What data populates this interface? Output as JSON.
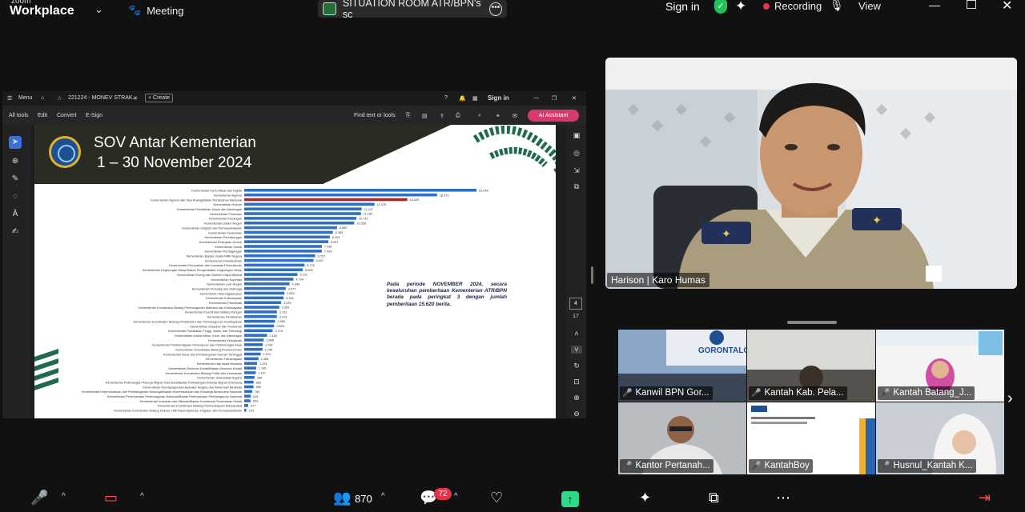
{
  "app": {
    "brand_small": "zoom",
    "brand": "Workplace",
    "meeting_label": "Meeting",
    "share_title": "SITUATION ROOM ATR/BPN's sc",
    "sign_in": "Sign in",
    "recording": "Recording",
    "view": "View"
  },
  "acrobat": {
    "menu": "Menu",
    "tab": "221224 - MONEV STRAK...",
    "create": "+ Create",
    "sign_in": "Sign in",
    "tools": [
      "All tools",
      "Edit",
      "Convert",
      "E-Sign"
    ],
    "find": "Find text or tools",
    "ai": "AI Assistant",
    "page": "4",
    "pages_total": "17"
  },
  "slide": {
    "title_line1": "SOV Antar Kementerian",
    "title_line2": "1 – 30 November 2024",
    "note": "Pada periode NOVEMBER 2024, secara keseluruhan pemberitaan Kementerian ATR/BPN berada pada peringkat 3 dengan jumlah pemberitaan 15.620 berita."
  },
  "chart_data": {
    "type": "bar",
    "orientation": "horizontal",
    "highlight_color": "#a12a2a",
    "bar_color": "#2f6fc4",
    "highlight_index": 2,
    "categories": [
      "Kementerian Komunikasi dan Digital",
      "Kementerian Agama",
      "Kementerian Agraria dan Tata Ruang/Badan Pertanahan Nasional",
      "Kementerian Hukum",
      "Kementerian Pendidikan Dasar dan Menengah",
      "Kementerian Pertanian",
      "Kementerian Keuangan",
      "Kementerian Dalam Negeri",
      "Kementerian Imigrasi dan Pemasyarakatan",
      "Kementerian Kesehatan",
      "Kementerian Perhubungan",
      "Kementerian Pekerjaan Umum",
      "Kementerian Sosial",
      "Kementerian Perdagangan",
      "Kementerian Badan Usaha Milik Negara",
      "Kementerian Perindustrian",
      "Kementerian Perumahan dan Kawasan Permukiman",
      "Kementerian Lingkungan Hidup/Badan Pengendalian Lingkungan Hidup",
      "Kementerian Energi dan Sumber Daya Mineral",
      "Kementerian Koperasi",
      "Kementerian Luar Negeri",
      "Kementerian Pemuda dan Olahraga",
      "Kementerian Ketenagakerjaan",
      "Kementerian Kebudayaan",
      "Kementerian Pariwisata",
      "Kementerian Koordinator Bidang Pembangunan Manusia dan Kebudayaan",
      "Kementerian Koordinator Bidang Pangan",
      "Kementerian Pertahanan",
      "Kementerian Koordinator Bidang Infrastruktur dan Pembangunan Kewilayahan",
      "Kementerian Kelautan dan Perikanan",
      "Kementerian Pendidikan Tinggi, Sains, dan Teknologi",
      "Kementerian Usaha Mikro, Kecil, dan Menengah",
      "Kementerian Kehutanan",
      "Kementerian Pemberdayaan Perempuan dan Perlindungan Anak",
      "Kementerian Koordinator Bidang Perekonomian",
      "Kementerian Desa dan Pembangunan Daerah Tertinggal",
      "Kementerian Transmigrasi",
      "Kementerian Hak Asasi Manusia",
      "Kementerian Ekonomi Kreatif/Badan Ekonomi Kreatif",
      "Kementerian Koordinator Bidang Politik dan Keamanan",
      "Kementerian Sekretariat Negara",
      "Kementerian Pelindungan Pekerja Migran Indonesia/Badan Pelindungan Pekerja Migran Indonesia",
      "Kementerian Pendayagunaan Aparatur Negara dan Reformasi Birokrasi",
      "Kementerian Kependudukan dan Pembangunan Keluarga/Badan Kependudukan dan Keluarga Berencana Nasional",
      "Kementerian Perencanaan Pembangunan Nasional/Badan Perencanaan Pembangunan Nasional",
      "Kementerian Investasi dan Hilirisasi/Badan Koordinasi Penanaman Modal",
      "Kementerian Koordinator Bidang Pemberdayaan Masyarakat",
      "Kementerian Koordinator Bidang Hukum, Hak Asasi Manusia, Imigrasi, dan Pemasyarakatan"
    ],
    "values": [
      22246,
      18473,
      15620,
      12476,
      11247,
      11183,
      10742,
      10536,
      8890,
      8483,
      8203,
      8057,
      7436,
      7428,
      6797,
      6637,
      5776,
      5605,
      5101,
      4709,
      4344,
      3977,
      3853,
      3764,
      3539,
      3359,
      3131,
      3123,
      2950,
      2855,
      2719,
      2183,
      1868,
      1764,
      1746,
      1574,
      1366,
      1224,
      1145,
      1107,
      985,
      889,
      889,
      764,
      616,
      604,
      377,
      193
    ],
    "value_labels": [
      "22.246",
      "18.473",
      "15.620",
      "12.476",
      "11.247",
      "11.183",
      "10.742",
      "10.536",
      "8.890",
      "8.483",
      "8.203",
      "8.057",
      "7.436",
      "7.428",
      "6.797",
      "6.637",
      "5.776",
      "5.605",
      "5.101",
      "4.709",
      "4.344",
      "3.977",
      "3.853",
      "3.764",
      "3.539",
      "3.359",
      "3.131",
      "3.123",
      "2.950",
      "2.855",
      "2.719",
      "2.183",
      "1.868",
      "1.764",
      "1.746",
      "1.574",
      "1.366",
      "1.224",
      "1.145",
      "1.107",
      "985",
      "889",
      "889",
      "764",
      "616",
      "604",
      "377",
      "193"
    ]
  },
  "speaker": {
    "name": "Harison | Karo Humas"
  },
  "gallery": [
    {
      "label": "Kanwil BPN Gor..."
    },
    {
      "label": "Kantah Kab. Pela..."
    },
    {
      "label": "Kantah Batang_J..."
    },
    {
      "label": "Kantor Pertanah..."
    },
    {
      "label": "KantahBoy"
    },
    {
      "label": "Husnul_Kantah K..."
    }
  ],
  "gallery_tile_text": {
    "gorontalo": "GORONTALO"
  },
  "bottombar": {
    "participants": "870",
    "chat_count": "72"
  },
  "colors": {
    "zoom_bg": "#111111",
    "recording_dot": "#e2334a",
    "share_green": "#2bd98a",
    "muted_red": "#ff4d5e"
  }
}
